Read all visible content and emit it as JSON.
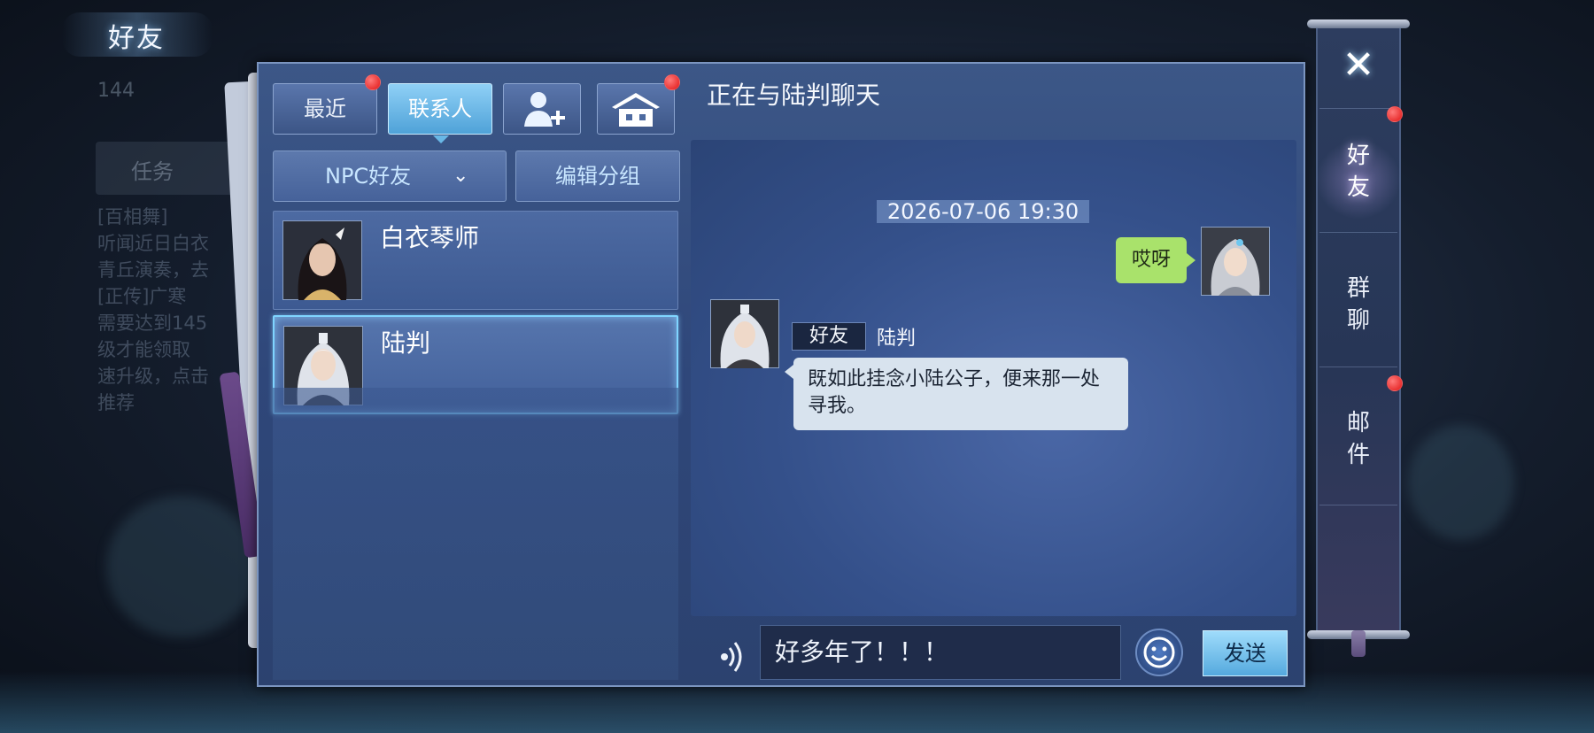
{
  "page": {
    "title": "好友"
  },
  "background": {
    "faded_number": "144",
    "faded_tab": "任务",
    "faded_lines": [
      "[百相舞]",
      "听闻近日白衣",
      "青丘演奏，去",
      "[正传]广寒",
      "需要达到145",
      "级才能领取",
      "速升级，点击",
      "推荐"
    ]
  },
  "tabs": [
    {
      "label": "最近",
      "active": false,
      "badge": true
    },
    {
      "label": "联系人",
      "active": true,
      "badge": false
    },
    {
      "label": "",
      "icon": "add-friend-icon",
      "active": false,
      "badge": false
    },
    {
      "label": "",
      "icon": "home-icon",
      "active": false,
      "badge": true
    }
  ],
  "group_selector": {
    "selected": "NPC好友",
    "chevron": "chevron-down-icon"
  },
  "edit_group_label": "编辑分组",
  "contacts": [
    {
      "name": "白衣琴师",
      "selected": false
    },
    {
      "name": "陆判",
      "selected": true
    }
  ],
  "chat": {
    "title": "正在与陆判聊天",
    "timestamp": "2026-07-06 19:30",
    "messages": [
      {
        "from": "self",
        "text": "哎呀"
      },
      {
        "from": "other",
        "tag": "好友",
        "sender": "陆判",
        "text": "既如此挂念小陆公子，便来那一处寻我。"
      }
    ],
    "input_value": "好多年了！！！",
    "send_label": "发送"
  },
  "side_nav": {
    "close_icon": "close-icon",
    "items": [
      {
        "label": "好友",
        "active": true,
        "badge": true
      },
      {
        "label": "群聊",
        "active": false,
        "badge": false
      },
      {
        "label": "邮件",
        "active": false,
        "badge": true
      }
    ]
  },
  "colors": {
    "accent": "#4fa2d8",
    "badge": "#e01414",
    "self_bubble": "#a9e26b",
    "other_bubble": "#d8e3ee"
  }
}
